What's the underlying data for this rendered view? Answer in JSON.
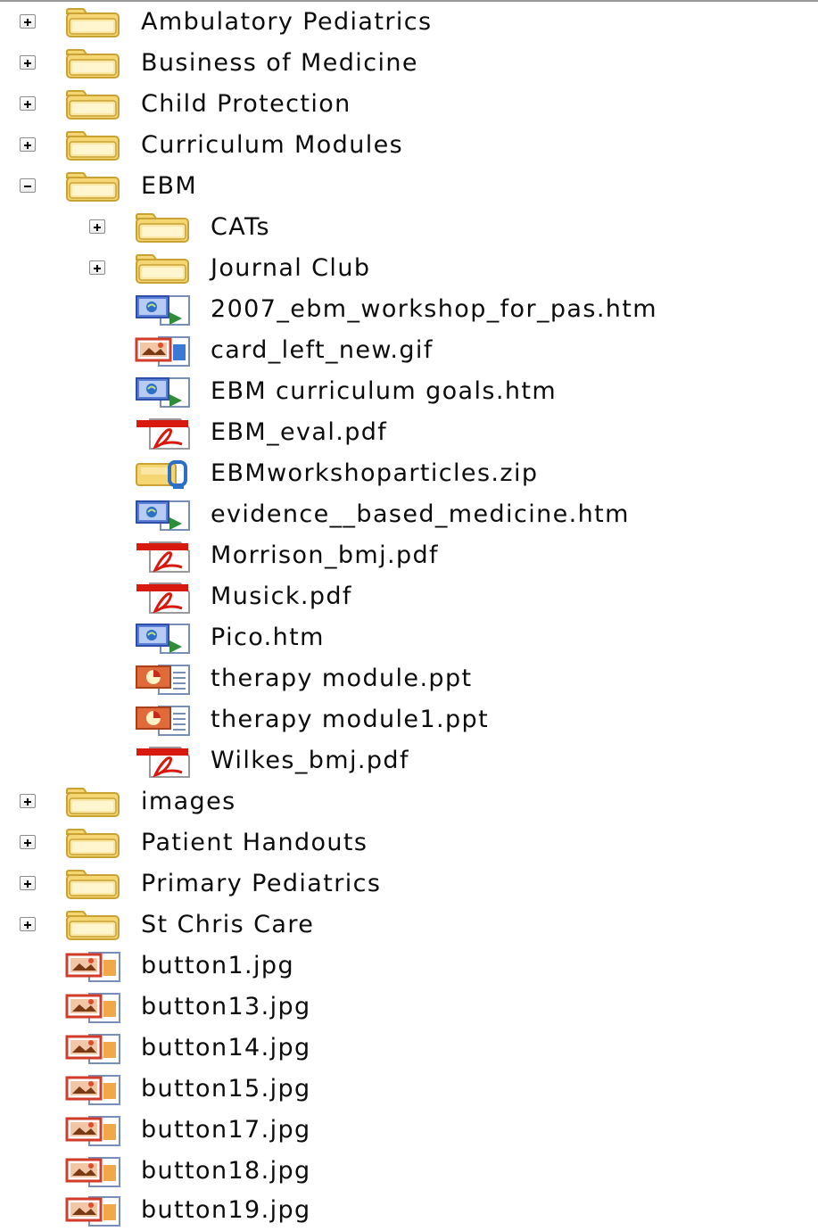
{
  "tree": {
    "ambulatory": {
      "label": "Ambulatory Pediatrics"
    },
    "business": {
      "label": "Business of Medicine"
    },
    "child": {
      "label": "Child Protection"
    },
    "curriculum": {
      "label": "Curriculum Modules"
    },
    "ebm": {
      "label": "EBM",
      "children": {
        "cats": {
          "label": "CATs"
        },
        "journal": {
          "label": "Journal Club"
        },
        "workshop_htm": {
          "label": "2007_ebm_workshop_for_pas.htm"
        },
        "card_gif": {
          "label": "card_left_new.gif"
        },
        "goals_htm": {
          "label": "EBM curriculum goals.htm"
        },
        "eval_pdf": {
          "label": "EBM_eval.pdf"
        },
        "articles_zip": {
          "label": "EBMworkshoparticles.zip"
        },
        "evidence_htm": {
          "label": "evidence__based_medicine.htm"
        },
        "morrison_pdf": {
          "label": "Morrison_bmj.pdf"
        },
        "musick_pdf": {
          "label": "Musick.pdf"
        },
        "pico_htm": {
          "label": "Pico.htm"
        },
        "therapy_ppt": {
          "label": "therapy module.ppt"
        },
        "therapy1_ppt": {
          "label": "therapy module1.ppt"
        },
        "wilkes_pdf": {
          "label": "Wilkes_bmj.pdf"
        }
      }
    },
    "images": {
      "label": "images"
    },
    "handouts": {
      "label": "Patient Handouts"
    },
    "primary": {
      "label": "Primary Pediatrics"
    },
    "stchris": {
      "label": "St Chris Care"
    },
    "button1": {
      "label": "button1.jpg"
    },
    "button13": {
      "label": "button13.jpg"
    },
    "button14": {
      "label": "button14.jpg"
    },
    "button15": {
      "label": "button15.jpg"
    },
    "button17": {
      "label": "button17.jpg"
    },
    "button18": {
      "label": "button18.jpg"
    },
    "button19": {
      "label": "button19.jpg"
    }
  },
  "icons": {
    "folder": "folder-icon",
    "html": "html-file-icon",
    "gif": "gif-image-icon",
    "pdf": "pdf-file-icon",
    "zip": "zip-archive-icon",
    "ppt": "powerpoint-file-icon",
    "jpg": "jpg-image-icon"
  },
  "colors": {
    "folder": "#f5d673",
    "folder_edge": "#c9a234",
    "pdf_red": "#d8190f",
    "html_blue": "#5a7ed6",
    "image_red": "#d23a2a",
    "ppt_orange": "#e06a3a"
  }
}
